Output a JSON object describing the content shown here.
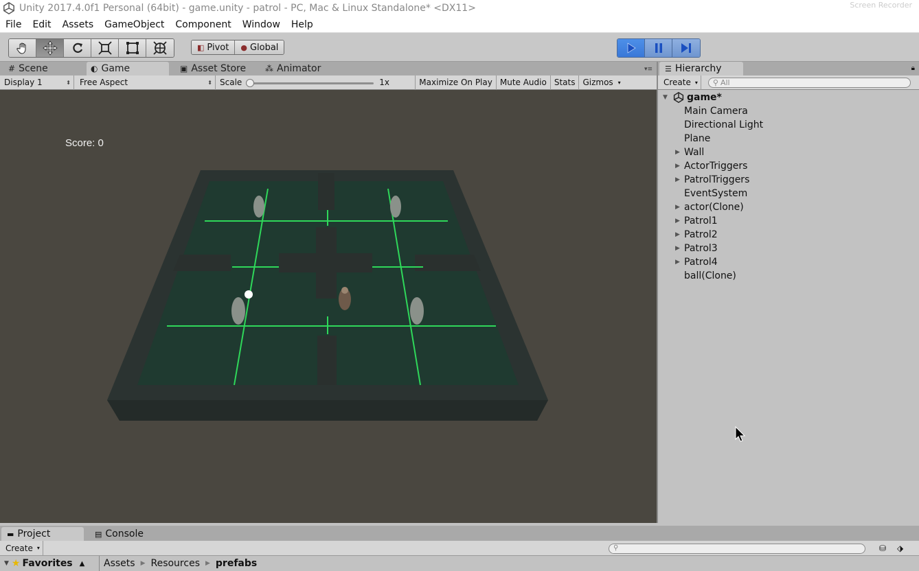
{
  "window": {
    "title": "Unity 2017.4.0f1 Personal (64bit) - game.unity - patrol - PC, Mac & Linux Standalone* <DX11>",
    "watermark": "Screen Recorder"
  },
  "menu": [
    "File",
    "Edit",
    "Assets",
    "GameObject",
    "Component",
    "Window",
    "Help"
  ],
  "toolbar": {
    "tools": [
      "hand-tool-icon",
      "move-tool-icon",
      "rotate-tool-icon",
      "scale-tool-icon",
      "rect-tool-icon",
      "transform-tool-icon"
    ],
    "active_tool_index": 1,
    "pivot_label": "Pivot",
    "global_label": "Global",
    "play_active": true
  },
  "tabs": {
    "scene": "Scene",
    "game": "Game",
    "asset_store": "Asset Store",
    "animator": "Animator"
  },
  "gamebar": {
    "display": "Display 1",
    "aspect": "Free Aspect",
    "scale_label": "Scale",
    "scale_value": "1x",
    "maximize": "Maximize On Play",
    "mute": "Mute Audio",
    "stats": "Stats",
    "gizmos": "Gizmos"
  },
  "game": {
    "score_text": "Score: 0"
  },
  "hierarchy": {
    "tab_label": "Hierarchy",
    "create_label": "Create",
    "search_placeholder": "All",
    "root": "game*",
    "items": [
      {
        "label": "Main Camera",
        "expandable": false
      },
      {
        "label": "Directional Light",
        "expandable": false
      },
      {
        "label": "Plane",
        "expandable": false
      },
      {
        "label": "Wall",
        "expandable": true
      },
      {
        "label": "ActorTriggers",
        "expandable": true
      },
      {
        "label": "PatrolTriggers",
        "expandable": true
      },
      {
        "label": "EventSystem",
        "expandable": false
      },
      {
        "label": "actor(Clone)",
        "expandable": true
      },
      {
        "label": "Patrol1",
        "expandable": true
      },
      {
        "label": "Patrol2",
        "expandable": true
      },
      {
        "label": "Patrol3",
        "expandable": true
      },
      {
        "label": "Patrol4",
        "expandable": true
      },
      {
        "label": "ball(Clone)",
        "expandable": false
      }
    ]
  },
  "bottom": {
    "project_tab": "Project",
    "console_tab": "Console",
    "create_label": "Create",
    "favorites": "Favorites",
    "breadcrumb": [
      "Assets",
      "Resources",
      "prefabs"
    ]
  },
  "colors": {
    "play_blue": "#3a78d8",
    "grid_green": "#2fd85a",
    "floor": "#1f3a30",
    "wall": "#2b3331",
    "viewport_bg": "#4a4740"
  }
}
